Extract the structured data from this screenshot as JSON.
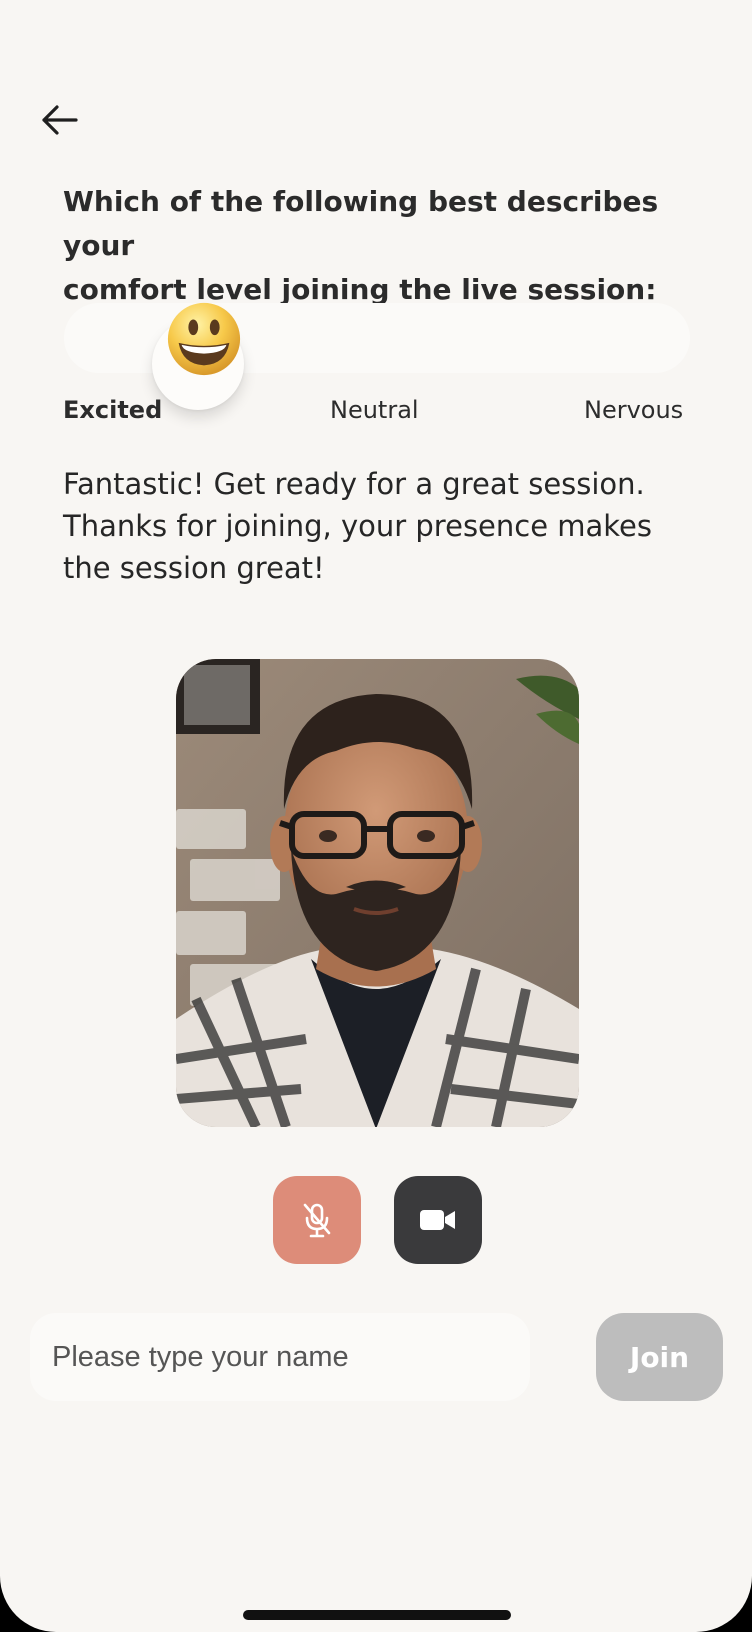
{
  "question": {
    "line1": "Which of the following best describes your",
    "line2": "comfort level joining the live session:"
  },
  "comfort_slider": {
    "labels": [
      "Excited",
      "Neutral",
      "Nervous"
    ],
    "selected": "Excited",
    "selected_emoji": "grinning-face-icon"
  },
  "feedback": {
    "line1": "Fantastic! Get ready for a great session.",
    "line2": "Thanks for joining, your presence makes",
    "line3": "the session great!"
  },
  "controls": {
    "mic": {
      "icon": "mic-off-icon",
      "state": "muted",
      "color": "#dd8c79"
    },
    "camera": {
      "icon": "video-camera-icon",
      "state": "on",
      "color": "#3a3a3c"
    }
  },
  "name_form": {
    "placeholder": "Please type your name",
    "value": "",
    "join_label": "Join"
  },
  "colors": {
    "background": "#f8f6f3",
    "join_disabled": "#bdbdbd"
  }
}
